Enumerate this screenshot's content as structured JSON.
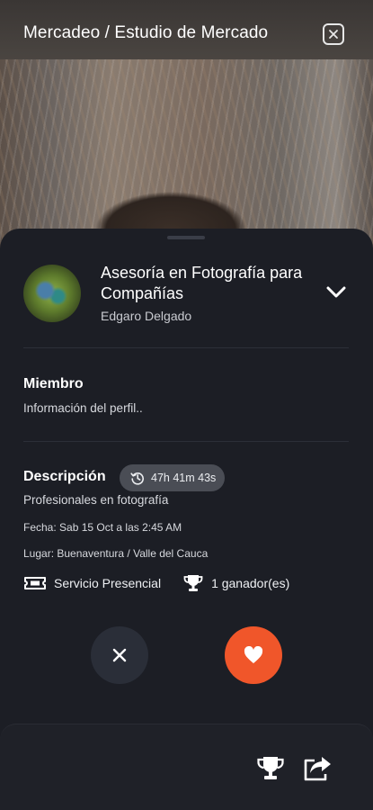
{
  "header": {
    "breadcrumb": "Mercadeo / Estudio de Mercado"
  },
  "card": {
    "title": "Asesoría en Fotografía para Compañías",
    "author": "Edgaro Delgado",
    "member": {
      "label": "Miembro",
      "text": "Información del perfil.."
    },
    "description": {
      "label": "Descripción",
      "timer": "47h 41m 43s",
      "text": "Profesionales en fotografía",
      "date": "Fecha: Sab 15 Oct a las 2:45 AM",
      "place": "Lugar: Buenaventura / Valle del Cauca"
    },
    "service_type": "Servicio Presencial",
    "winners": "1 ganador(es)"
  },
  "icons": {
    "close": "close-icon",
    "chevron": "chevron-down-icon",
    "history": "history-icon",
    "ticket": "ticket-icon",
    "trophy": "trophy-icon",
    "dismiss": "x-icon",
    "like": "heart-icon",
    "share": "share-icon"
  },
  "colors": {
    "sheet_bg": "#1c1e25",
    "accent": "#f0562a",
    "pill_bg": "#4a4d55"
  }
}
